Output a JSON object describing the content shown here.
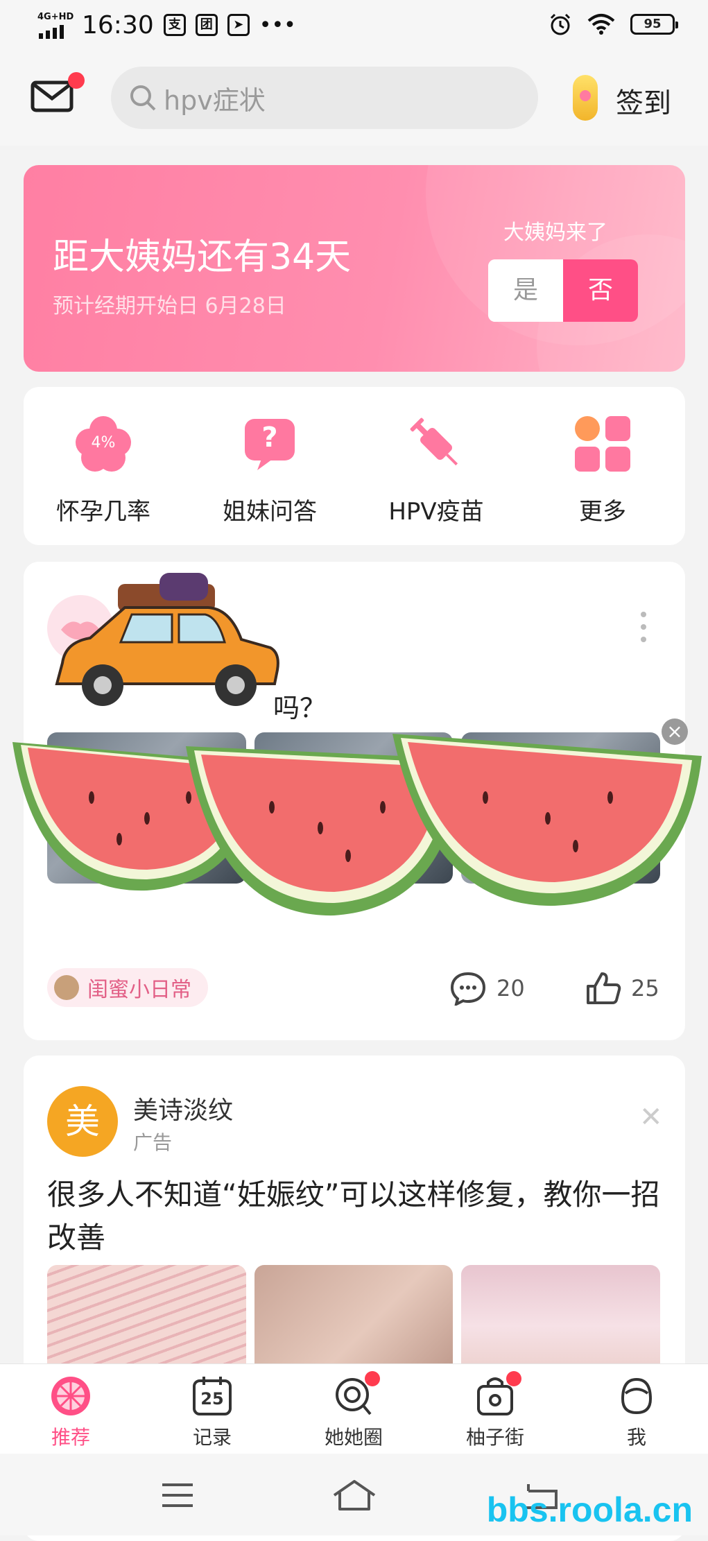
{
  "status": {
    "network": "4G+HD",
    "time": "16:30",
    "apps": [
      "支",
      "团"
    ],
    "battery": "95"
  },
  "header": {
    "search_placeholder": "hpv症状",
    "signin_label": "签到"
  },
  "period_card": {
    "countdown": "距大姨妈还有34天",
    "expected_start": "预计经期开始日 6月28日",
    "question": "大姨妈来了",
    "yes_label": "是",
    "no_label": "否"
  },
  "shortcuts": [
    {
      "label": "怀孕几率",
      "badge": "4%"
    },
    {
      "label": "姐妹问答",
      "badge": "?"
    },
    {
      "label": "HPV疫苗"
    },
    {
      "label": "更多"
    }
  ],
  "post": {
    "title_tail": "吗？",
    "tag": "闺蜜小日常",
    "comments": "20",
    "likes": "25"
  },
  "ad": {
    "avatar_text": "美",
    "name": "美诗淡纹",
    "label": "广告",
    "text": "很多人不知道“妊娠纹”可以这样修复，教你一招改善"
  },
  "bottom_nav": [
    {
      "label": "推荐",
      "active": true
    },
    {
      "label": "记录",
      "badge": "25"
    },
    {
      "label": "她她圈"
    },
    {
      "label": "柚子街"
    },
    {
      "label": "我"
    }
  ],
  "watermark": "bbs.roola.cn",
  "colors": {
    "accent": "#ff4f86",
    "period_gradient_start": "#ff7fa3",
    "notification_dot": "#ff3b4e",
    "watermark": "#19c3f0"
  }
}
